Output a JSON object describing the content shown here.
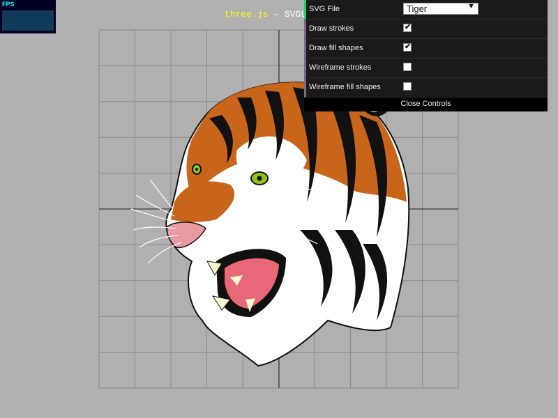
{
  "fps": {
    "label": "FPS"
  },
  "info": {
    "link": "three.js",
    "separator": "-",
    "title": "SVGLoader"
  },
  "gui": {
    "svg_file": {
      "label": "SVG File",
      "value": "Tiger"
    },
    "draw_strokes": {
      "label": "Draw strokes",
      "checked": true
    },
    "draw_fill": {
      "label": "Draw fill shapes",
      "checked": true
    },
    "wire_strokes": {
      "label": "Wireframe strokes",
      "checked": false
    },
    "wire_fill": {
      "label": "Wireframe fill shapes",
      "checked": false
    },
    "close_label": "Close Controls"
  },
  "icons": {
    "check": "check-icon",
    "dropdown": "triangle-down-icon"
  },
  "colors": {
    "background": "#b0b0b0",
    "panel": "#1a1a1a",
    "grid": "#888888",
    "axis": "#222222",
    "link": "#ffff00"
  }
}
